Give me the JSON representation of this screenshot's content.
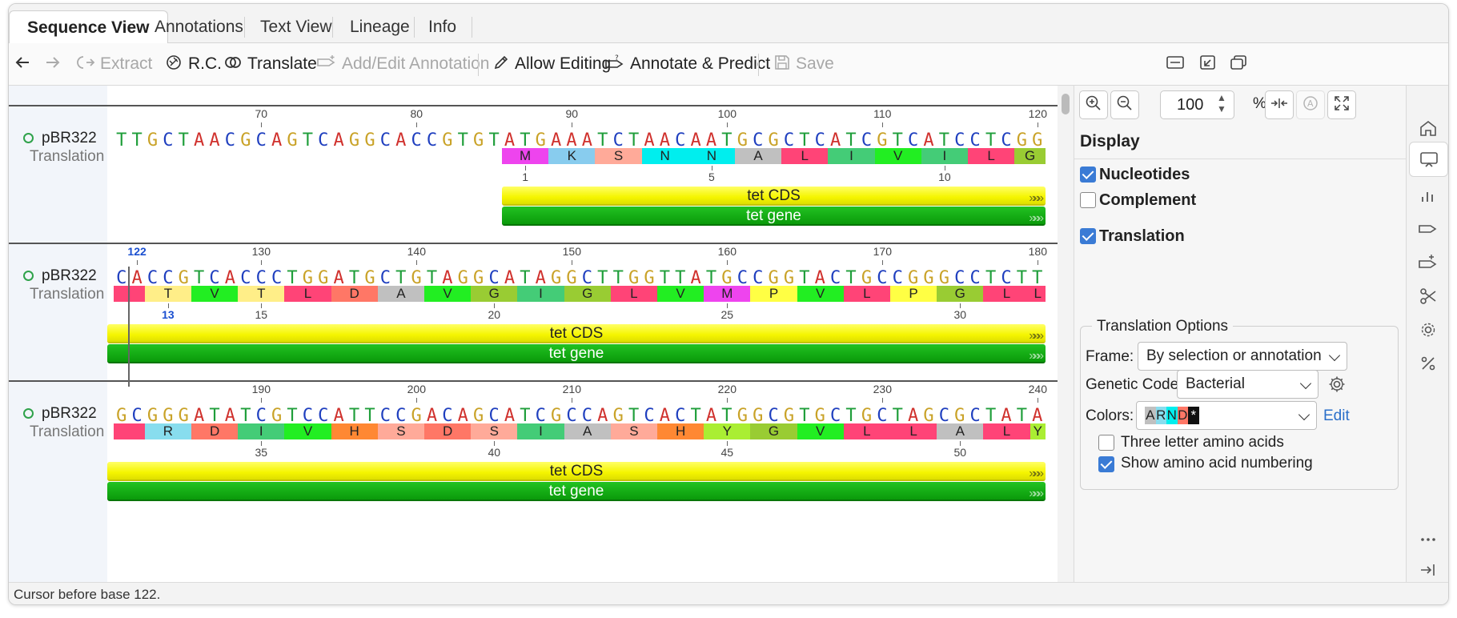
{
  "tabs": [
    {
      "label": "Sequence View",
      "active": true
    },
    {
      "label": "Annotations"
    },
    {
      "label": "Text View"
    },
    {
      "label": "Lineage"
    },
    {
      "label": "Info"
    }
  ],
  "toolbar": {
    "back_icon": "arrow-left-icon",
    "forward_icon": "arrow-right-icon",
    "extract": "Extract",
    "rc": "R.C.",
    "translate": "Translate",
    "add_edit": "Add/Edit Annotation",
    "allow_editing": "Allow Editing",
    "annotate_predict": "Annotate & Predict",
    "save": "Save"
  },
  "sequence": {
    "name": "pBR322",
    "track": "Translation",
    "rows": [
      {
        "bases": "TTGCTAACGCAGTCAGGCACCGTGTATGAAATCTAACAATGCGCTCATCGTCATCCTCGG",
        "ruler": [
          {
            "label": "70",
            "pos": 10
          },
          {
            "label": "80",
            "pos": 20
          },
          {
            "label": "90",
            "pos": 30
          },
          {
            "label": "100",
            "pos": 40
          },
          {
            "label": "110",
            "pos": 50
          },
          {
            "label": "120",
            "pos": 60
          }
        ],
        "aa_start": 25,
        "aa": [
          "M",
          "K",
          "S",
          "N",
          "N",
          "A",
          "L",
          "I",
          "V",
          "I",
          "L",
          "G"
        ],
        "aa_nums": [
          {
            "label": "1",
            "idx": 0
          },
          {
            "label": "5",
            "idx": 4
          },
          {
            "label": "10",
            "idx": 9
          }
        ],
        "feat_start": 25,
        "cds": "tet CDS",
        "gene": "tet gene"
      },
      {
        "bases": "CACCGTCACCCTGGATGCTGTAGGCATAGGCTTGGTTATGCCGGTACTGCCGGGCCTCTT",
        "ruler": [
          {
            "label": "122",
            "pos": 2,
            "cursor": true
          },
          {
            "label": "130",
            "pos": 10
          },
          {
            "label": "140",
            "pos": 20
          },
          {
            "label": "150",
            "pos": 30
          },
          {
            "label": "160",
            "pos": 40
          },
          {
            "label": "170",
            "pos": 50
          },
          {
            "label": "180",
            "pos": 60
          }
        ],
        "aa_start": -1,
        "aa": [
          "",
          "T",
          "V",
          "T",
          "L",
          "D",
          "A",
          "V",
          "G",
          "I",
          "G",
          "L",
          "V",
          "M",
          "P",
          "V",
          "L",
          "P",
          "G",
          "L",
          "L"
        ],
        "aa_nums": [
          {
            "label": "13",
            "idx": 1,
            "cursor": true
          },
          {
            "label": "15",
            "idx": 3
          },
          {
            "label": "20",
            "idx": 8
          },
          {
            "label": "25",
            "idx": 13
          },
          {
            "label": "30",
            "idx": 18
          }
        ],
        "feat_start": 0,
        "cds": "tet CDS",
        "gene": "tet gene"
      },
      {
        "bases": "GCGGGATATCGTCCATTCCGACAGCATCGCCAGTCACTATGGCGTGCTGCTAGCGCTATA",
        "ruler": [
          {
            "label": "190",
            "pos": 10
          },
          {
            "label": "200",
            "pos": 20
          },
          {
            "label": "210",
            "pos": 30
          },
          {
            "label": "220",
            "pos": 40
          },
          {
            "label": "230",
            "pos": 50
          },
          {
            "label": "240",
            "pos": 60
          }
        ],
        "aa_start": -1,
        "aa": [
          "",
          "R",
          "D",
          "I",
          "V",
          "H",
          "S",
          "D",
          "S",
          "I",
          "A",
          "S",
          "H",
          "Y",
          "G",
          "V",
          "L",
          "L",
          "A",
          "L",
          "Y"
        ],
        "aa_nums": [
          {
            "label": "35",
            "idx": 3
          },
          {
            "label": "40",
            "idx": 8
          },
          {
            "label": "45",
            "idx": 13
          },
          {
            "label": "50",
            "idx": 18
          }
        ],
        "feat_start": 0,
        "cds": "tet CDS",
        "gene": "tet gene"
      }
    ]
  },
  "base_colors": {
    "A": "#d0312d",
    "C": "#1f3fbf",
    "G": "#c9a227",
    "T": "#1f9e3a"
  },
  "aa_colors": {
    "M": "#ee44ee",
    "K": "#88ccee",
    "S": "#ffaa99",
    "N": "#00eeee",
    "A": "#c0c0c0",
    "L": "#ff4477",
    "I": "#44cc77",
    "V": "#22ee22",
    "G": "#99cc33",
    "T": "#ffee88",
    "D": "#ff7766",
    "R": "#88ddee",
    "H": "#ff8833",
    "Y": "#aaee33",
    "P": "#ffff44",
    "": "#ff4477"
  },
  "panel": {
    "zoom_value": "100",
    "zoom_unit": "%",
    "heading": "Display",
    "nucleotides": {
      "label": "Nucleotides",
      "checked": true
    },
    "complement": {
      "label": "Complement",
      "checked": false
    },
    "translation": {
      "label": "Translation",
      "checked": true
    },
    "options_title": "Translation Options",
    "frame_label": "Frame:",
    "frame_value": "By selection or annotation",
    "code_label": "Genetic Code:",
    "code_value": "Bacterial",
    "colors_label": "Colors:",
    "colors_sample": [
      "A",
      "R",
      "N",
      "D",
      "*"
    ],
    "edit_link": "Edit",
    "three_letter": {
      "label": "Three letter amino acids",
      "checked": false
    },
    "show_numbering": {
      "label": "Show amino acid numbering",
      "checked": true
    }
  },
  "status": "Cursor before base 122."
}
